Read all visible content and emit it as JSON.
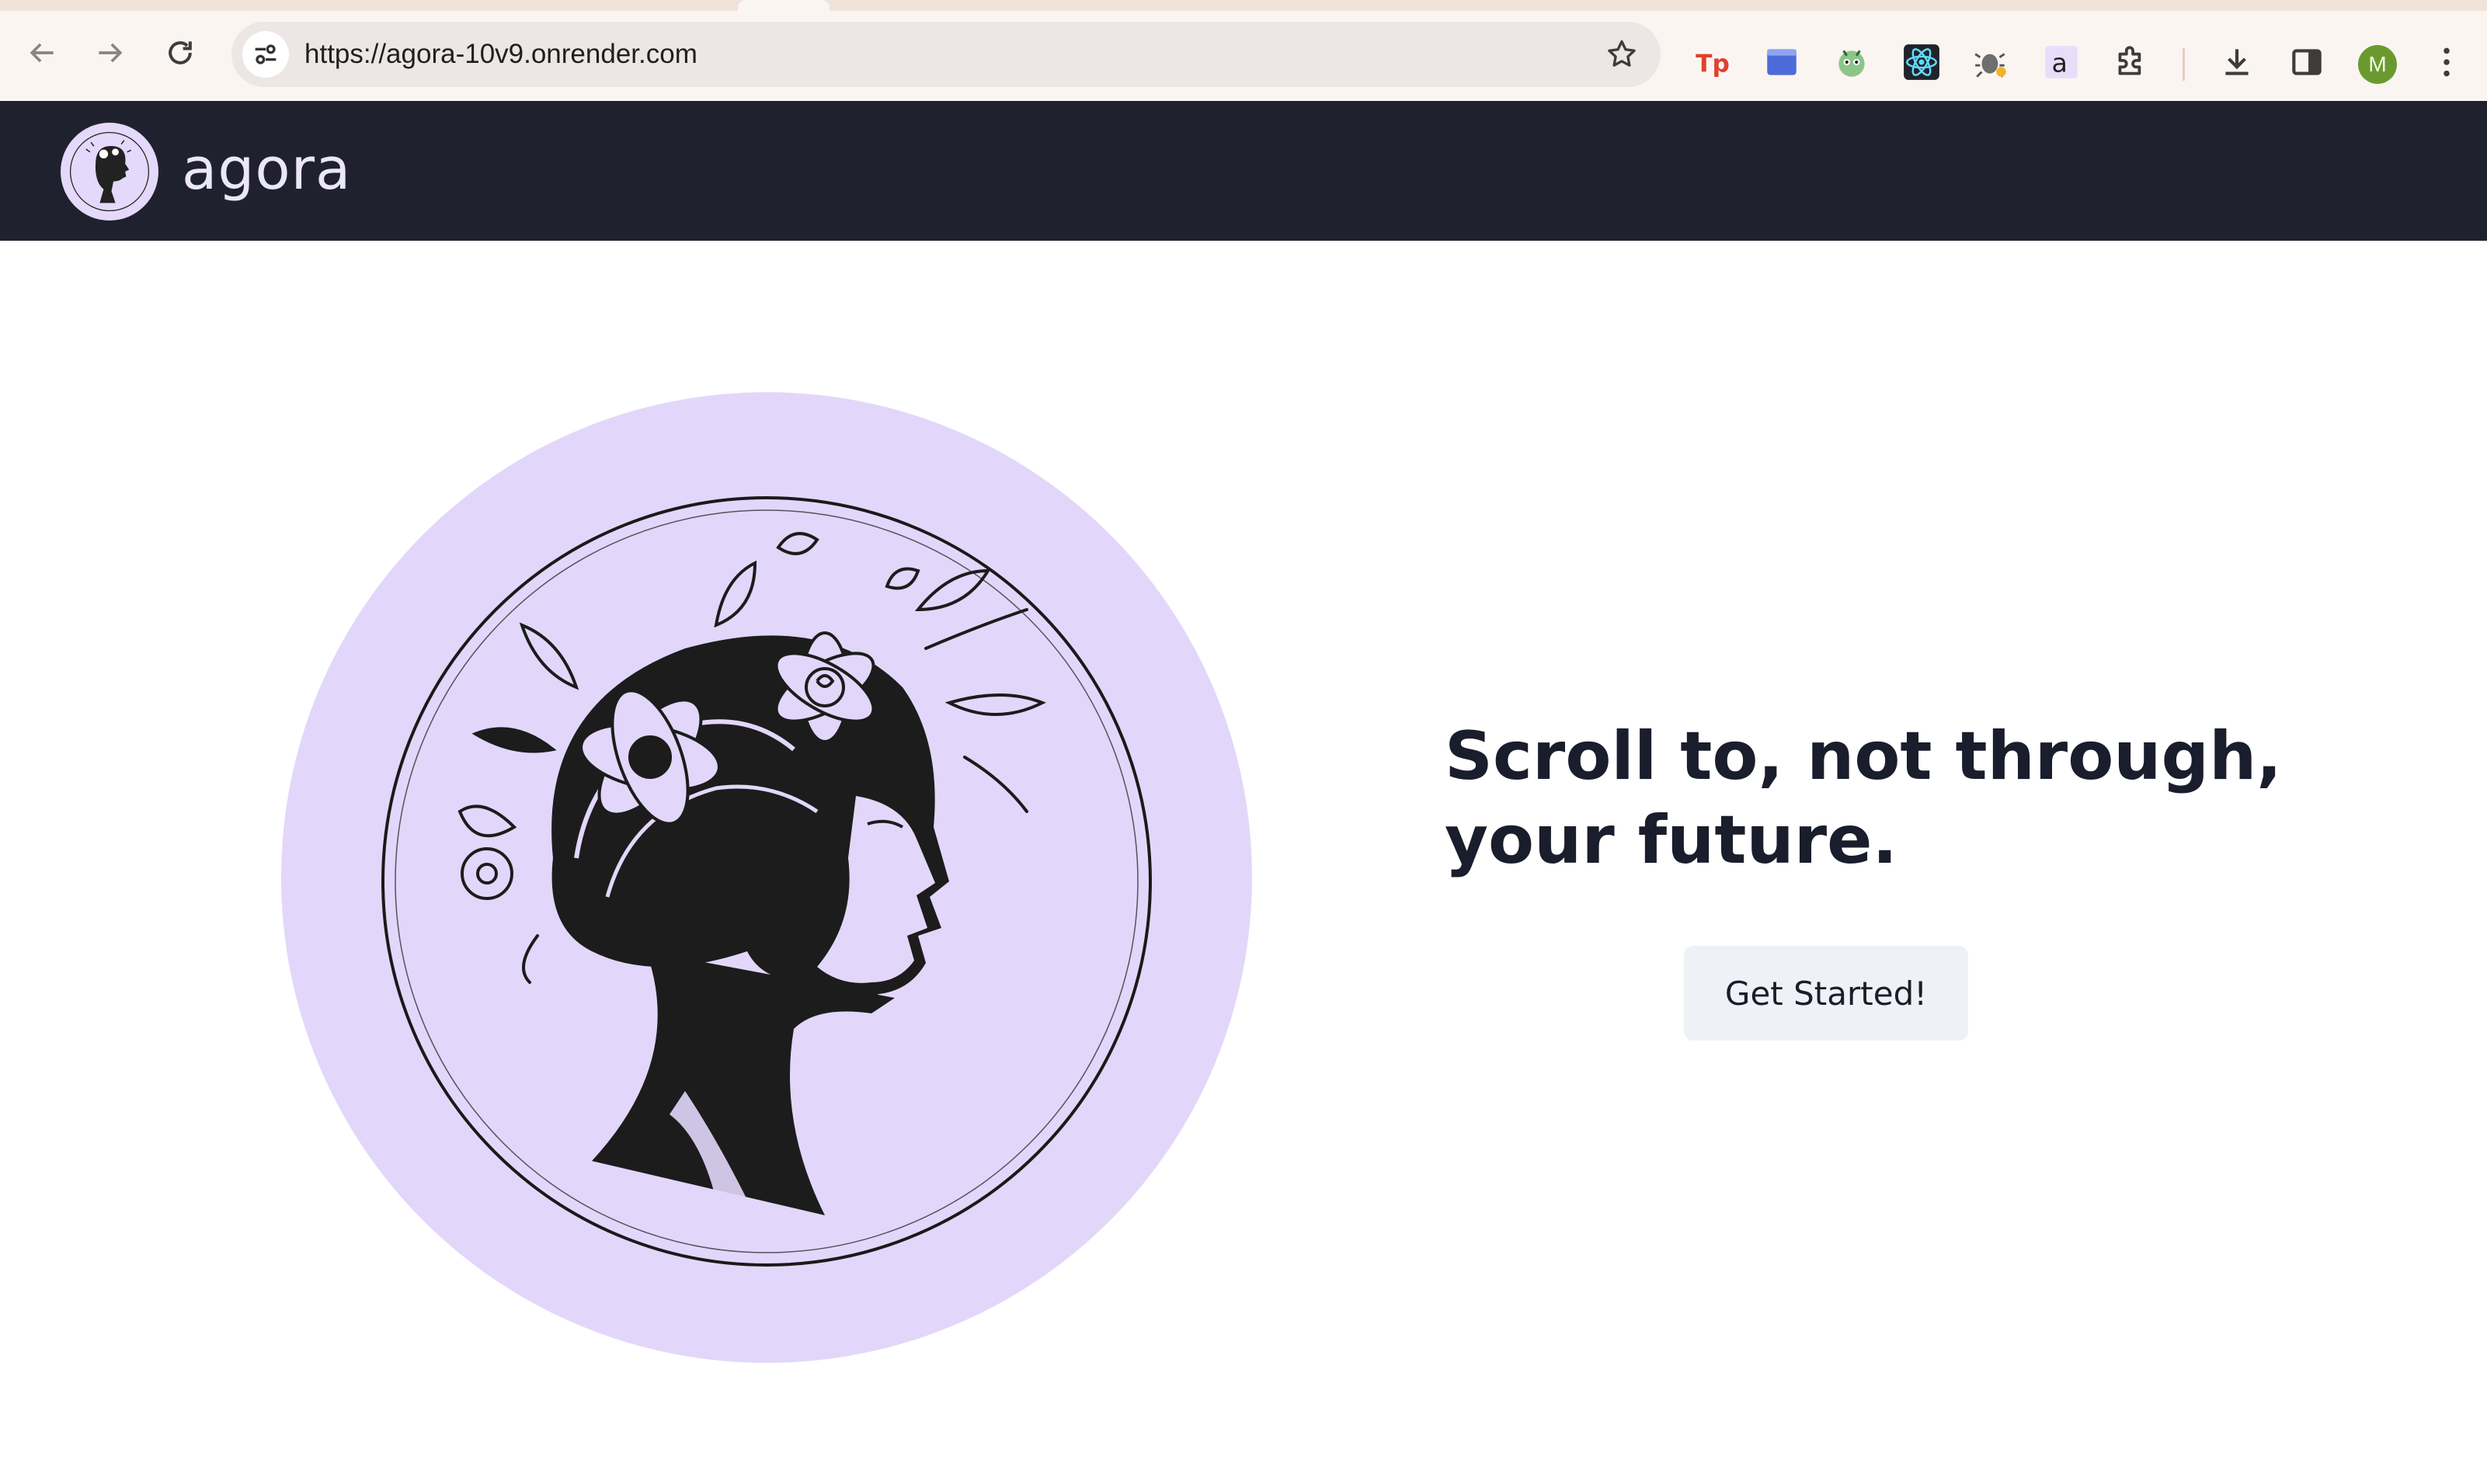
{
  "browser": {
    "url": "https://agora-10v9.onrender.com",
    "profile_initial": "M",
    "extensions": [
      {
        "icon": "tp-extension-icon"
      },
      {
        "icon": "blue-window-extension-icon"
      },
      {
        "icon": "green-bot-extension-icon"
      },
      {
        "icon": "react-devtools-icon"
      },
      {
        "icon": "bug-extension-icon"
      },
      {
        "icon": "a-letter-extension-icon"
      },
      {
        "icon": "puzzle-extensions-icon"
      }
    ],
    "toolbar_icons": [
      "back-icon",
      "forward-icon",
      "reload-icon",
      "site-info-icon",
      "bookmark-star-icon",
      "download-icon",
      "side-panel-icon",
      "more-menu-icon"
    ]
  },
  "site": {
    "name": "agora",
    "logo_icon": "agora-profile-head-logo"
  },
  "hero": {
    "illustration": "floral-head-profile-illustration",
    "tagline_line1": "Scroll to, not through,",
    "tagline_line2": "your future.",
    "cta_label": "Get Started!"
  },
  "colors": {
    "header_bg": "#1f222e",
    "hero_circle": "#e2d7fa",
    "text_dark": "#1a1d2b",
    "cta_bg": "#eef1f6",
    "chrome_bg": "#fbf5f2"
  }
}
